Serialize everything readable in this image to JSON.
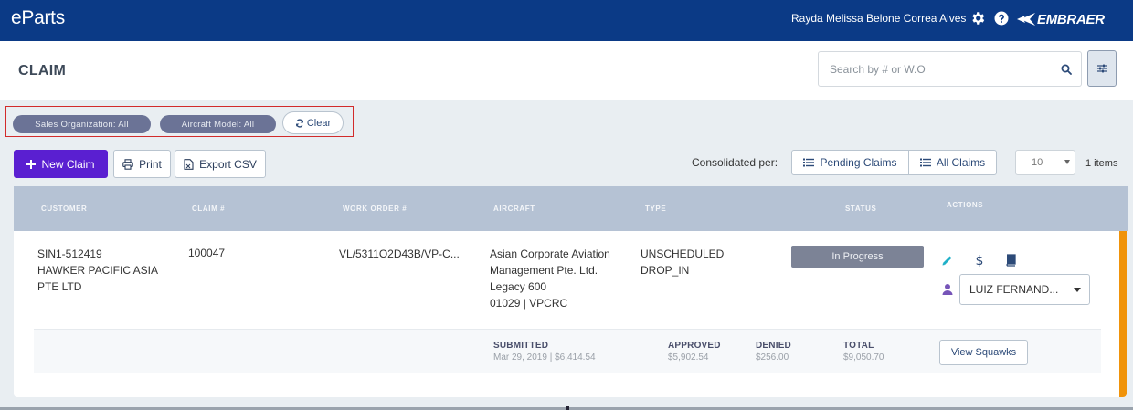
{
  "app": {
    "logo": "eParts",
    "user_name": "Rayda Melissa Belone Correa Alves",
    "brand": "EMBRAER",
    "icons": {
      "settings": "gear-icon",
      "help": "help-icon",
      "brand": "embraer-logo"
    }
  },
  "header": {
    "title": "CLAIM",
    "search_placeholder": "Search by # or W.O",
    "search_value": ""
  },
  "filters": {
    "sales_org": "Sales Organization: All",
    "aircraft_model": "Aircraft Model: All",
    "clear_label": "Clear"
  },
  "toolbar": {
    "new_claim": "New Claim",
    "print": "Print",
    "export_csv": "Export CSV",
    "consolidated_label": "Consolidated per:",
    "pending_claims": "Pending Claims",
    "all_claims": "All Claims",
    "page_size": "10",
    "item_count": "1 items"
  },
  "table": {
    "columns": [
      "CUSTOMER",
      "CLAIM #",
      "WORK ORDER #",
      "AIRCRAFT",
      "TYPE",
      "STATUS",
      "ACTIONS"
    ],
    "rows": [
      {
        "customer_id": "SIN1-512419",
        "customer_name_1": "HAWKER PACIFIC ASIA",
        "customer_name_2": "PTE LTD",
        "claim_number": "100047",
        "work_order": "VL/5311O2D43B/VP-C...",
        "aircraft_1": "Asian Corporate Aviation",
        "aircraft_2": "Management Pte. Ltd.",
        "aircraft_3": "Legacy 600",
        "aircraft_4": "01029 | VPCRC",
        "type_1": "UNSCHEDULED",
        "type_2": "DROP_IN",
        "status": "In Progress",
        "assignee": "LUIZ FERNAND...",
        "summary": {
          "submitted_label": "SUBMITTED",
          "submitted_value": "Mar 29, 2019 | $6,414.54",
          "approved_label": "APPROVED",
          "approved_value": "$5,902.54",
          "denied_label": "DENIED",
          "denied_value": "$256.00",
          "total_label": "TOTAL",
          "total_value": "$9,050.70",
          "view_squawks": "View Squawks"
        }
      }
    ]
  },
  "colors": {
    "topbar": "#0b3a86",
    "primary_button": "#5a1fd1",
    "status_badge": "#7c8396",
    "row_accent": "#f0930a",
    "filter_chip": "#6b7396",
    "table_header": "#b5c2d4"
  }
}
